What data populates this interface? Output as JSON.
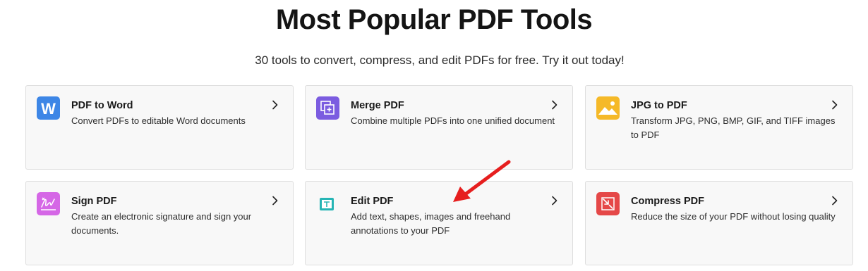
{
  "header": {
    "title": "Most Popular PDF Tools",
    "subtitle": "30 tools to convert, compress, and edit PDFs for free. Try it out today!"
  },
  "tools": [
    {
      "title": "PDF to Word",
      "desc": "Convert PDFs to editable Word documents",
      "icon": "word-icon",
      "color": "#3d86e6"
    },
    {
      "title": "Merge PDF",
      "desc": "Combine multiple PDFs into one unified document",
      "icon": "merge-icon",
      "color": "#7b5ce0"
    },
    {
      "title": "JPG to PDF",
      "desc": "Transform JPG, PNG, BMP, GIF, and TIFF images to PDF",
      "icon": "image-icon",
      "color": "#f5b928"
    },
    {
      "title": "Sign PDF",
      "desc": "Create an electronic signature and sign your documents.",
      "icon": "signature-icon",
      "color": "#d567e6"
    },
    {
      "title": "Edit PDF",
      "desc": "Add text, shapes, images and freehand annotations to your PDF",
      "icon": "text-edit-icon",
      "color": "#26b5b5"
    },
    {
      "title": "Compress PDF",
      "desc": "Reduce the size of your PDF without losing quality",
      "icon": "compress-icon",
      "color": "#e54848"
    }
  ],
  "annotation": {
    "arrow_color": "#e61e1e",
    "arrow_target": "Edit PDF"
  }
}
